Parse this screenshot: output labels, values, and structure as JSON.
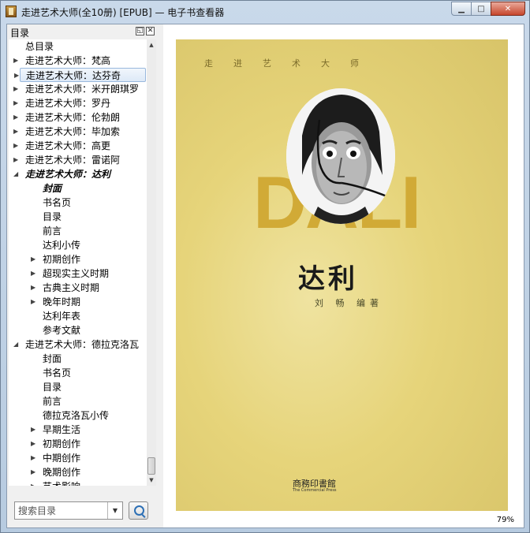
{
  "window": {
    "title": "走进艺术大师(全10册) [EPUB] — 电子书查看器",
    "min_icon": "minimize-icon",
    "max_icon": "maximize-icon",
    "close_icon": "close-icon"
  },
  "toc": {
    "title": "目录",
    "items": [
      {
        "label": "总目录",
        "level": 0,
        "arrow": ""
      },
      {
        "label": "走进艺术大师：梵高",
        "level": 0,
        "arrow": "▶"
      },
      {
        "label": "走进艺术大师：达芬奇",
        "level": 0,
        "arrow": "▶",
        "selected": true
      },
      {
        "label": "走进艺术大师：米开朗琪罗",
        "level": 0,
        "arrow": "▶"
      },
      {
        "label": "走进艺术大师：罗丹",
        "level": 0,
        "arrow": "▶"
      },
      {
        "label": "走进艺术大师：伦勃朗",
        "level": 0,
        "arrow": "▶"
      },
      {
        "label": "走进艺术大师：毕加索",
        "level": 0,
        "arrow": "▶"
      },
      {
        "label": "走进艺术大师：高更",
        "level": 0,
        "arrow": "▶"
      },
      {
        "label": "走进艺术大师：雷诺阿",
        "level": 0,
        "arrow": "▶"
      },
      {
        "label": "走进艺术大师：达利",
        "level": 0,
        "arrow": "◢",
        "current": true
      },
      {
        "label": "封面",
        "level": 1,
        "arrow": "",
        "current": true
      },
      {
        "label": "书名页",
        "level": 1,
        "arrow": ""
      },
      {
        "label": "目录",
        "level": 1,
        "arrow": ""
      },
      {
        "label": "前言",
        "level": 1,
        "arrow": ""
      },
      {
        "label": "达利小传",
        "level": 1,
        "arrow": ""
      },
      {
        "label": "初期创作",
        "level": 1,
        "arrow": "▶"
      },
      {
        "label": "超现实主义时期",
        "level": 1,
        "arrow": "▶"
      },
      {
        "label": "古典主义时期",
        "level": 1,
        "arrow": "▶"
      },
      {
        "label": "晚年时期",
        "level": 1,
        "arrow": "▶"
      },
      {
        "label": "达利年表",
        "level": 1,
        "arrow": ""
      },
      {
        "label": "参考文献",
        "level": 1,
        "arrow": ""
      },
      {
        "label": "走进艺术大师：德拉克洛瓦",
        "level": 0,
        "arrow": "◢"
      },
      {
        "label": "封面",
        "level": 1,
        "arrow": ""
      },
      {
        "label": "书名页",
        "level": 1,
        "arrow": ""
      },
      {
        "label": "目录",
        "level": 1,
        "arrow": ""
      },
      {
        "label": "前言",
        "level": 1,
        "arrow": ""
      },
      {
        "label": "德拉克洛瓦小传",
        "level": 1,
        "arrow": ""
      },
      {
        "label": "早期生活",
        "level": 1,
        "arrow": "▶"
      },
      {
        "label": "初期创作",
        "level": 1,
        "arrow": "▶"
      },
      {
        "label": "中期创作",
        "level": 1,
        "arrow": "▶"
      },
      {
        "label": "晚期创作",
        "level": 1,
        "arrow": "▶"
      },
      {
        "label": "艺术影响",
        "level": 1,
        "arrow": "▶"
      }
    ]
  },
  "search": {
    "placeholder": "搜索目录",
    "dropdown_icon": "▼",
    "button_icon": "search-icon"
  },
  "cover": {
    "series": "走进艺术大师",
    "big_text": "DALI",
    "title": "达利",
    "author": "刘 畅 编著",
    "publisher": "商務印書館",
    "publisher_en": "The Commercial Press"
  },
  "status": {
    "zoom": "79%"
  },
  "colors": {
    "cover_yellow": "#e9d87f",
    "dali_gold": "#d1aa36",
    "selection": "#dde9f7"
  }
}
